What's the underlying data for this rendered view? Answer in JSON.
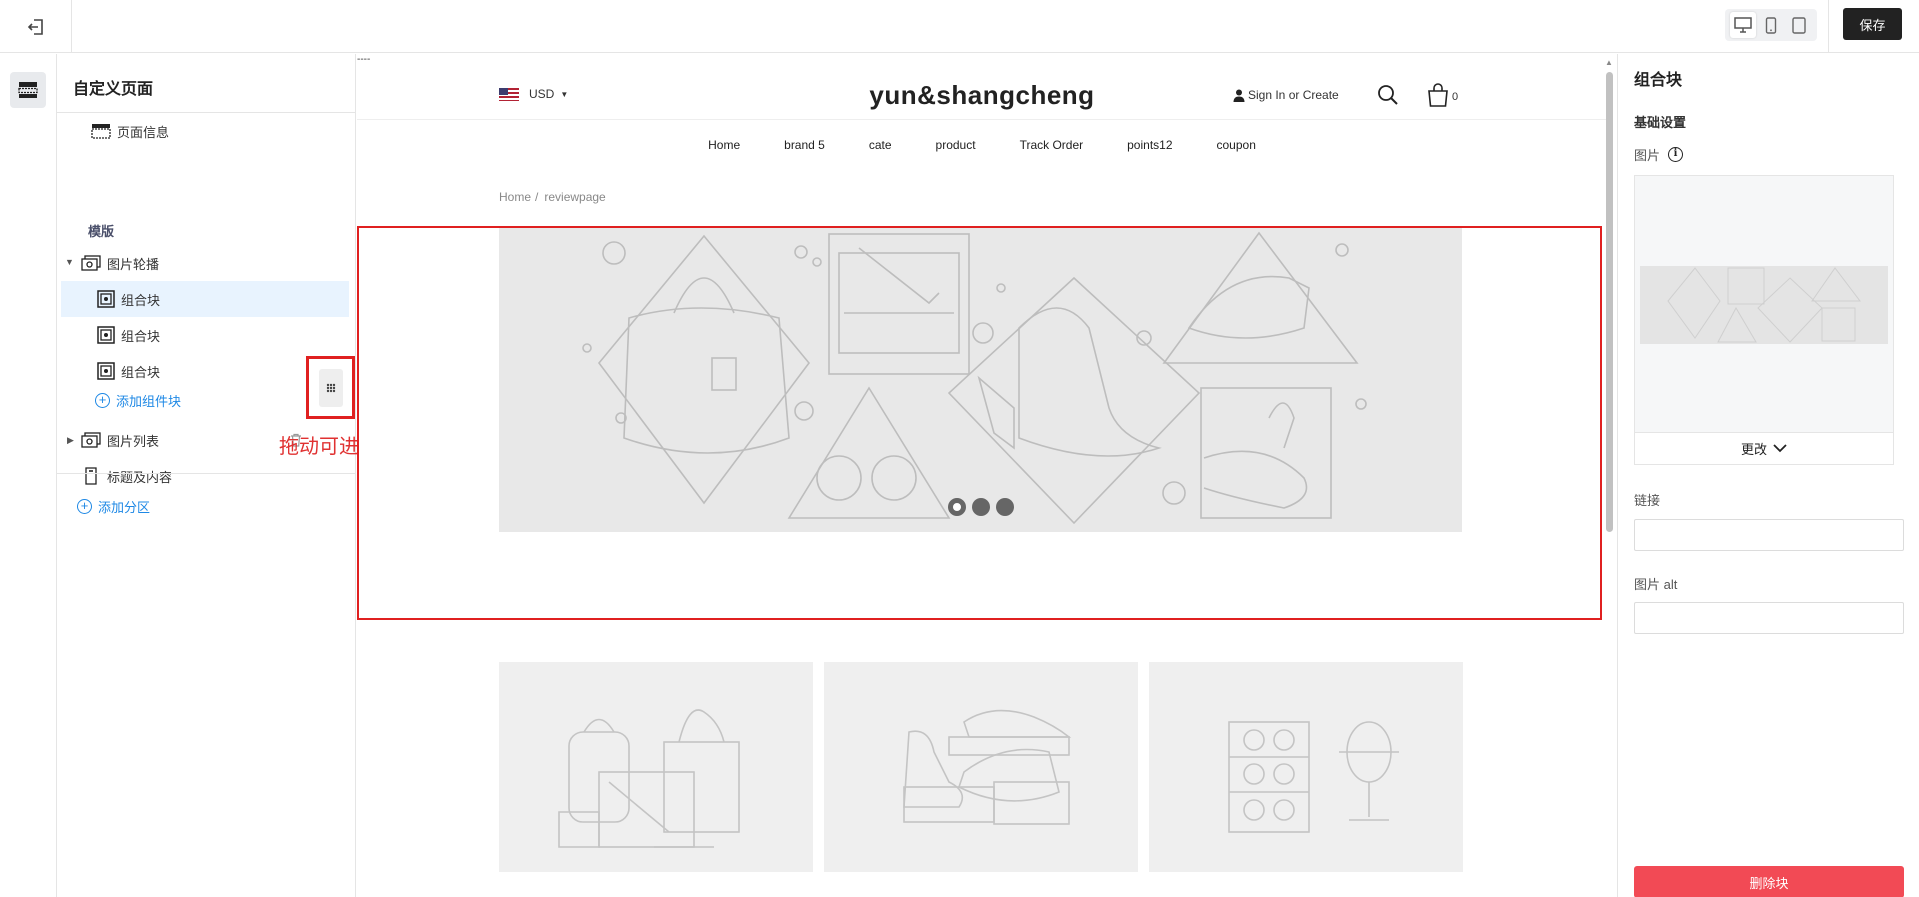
{
  "topbar": {
    "save_label": "保存",
    "devices": [
      "desktop-icon",
      "mobile-icon",
      "tablet-icon"
    ]
  },
  "sidebar": {
    "title": "自定义页面",
    "page_info": "页面信息",
    "template_label": "模版",
    "sections": [
      {
        "label": "图片轮播",
        "blocks": [
          "组合块",
          "组合块",
          "组合块"
        ],
        "add_block": "添加组件块"
      },
      {
        "label": "图片列表"
      },
      {
        "label": "标题及内容"
      }
    ],
    "add_section": "添加分区",
    "drag_hint": "拖动可进行组件排序"
  },
  "canvas": {
    "marker": "----",
    "currency": "USD",
    "brand": "yun&shangcheng",
    "signin": "Sign In or Create",
    "cart_count": "0",
    "nav": [
      "Home",
      "brand 5",
      "cate",
      "product",
      "Track Order",
      "points12",
      "coupon"
    ],
    "breadcrumb": {
      "home": "Home",
      "sep": "/",
      "current": "reviewpage"
    },
    "slider": {
      "slides": 3,
      "active": 1
    }
  },
  "panel": {
    "title": "组合块",
    "basic_settings": "基础设置",
    "image_label": "图片",
    "change_label": "更改",
    "link_label": "链接",
    "link_value": "",
    "alt_label": "图片 alt",
    "alt_value": "",
    "delete_label": "删除块"
  },
  "colors": {
    "accent": "#1e88e5",
    "selection": "#e02020",
    "danger": "#f24a55",
    "save_bg": "#222222",
    "selected_row": "#e8f3fe"
  }
}
